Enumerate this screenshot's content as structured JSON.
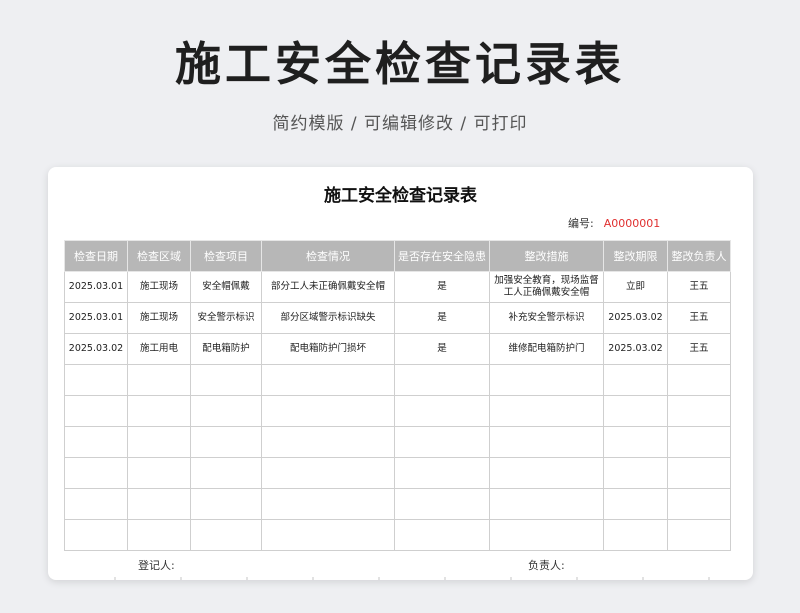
{
  "hero": {
    "title": "施工安全检查记录表",
    "subtitle": "简约模版 / 可编辑修改 / 可打印"
  },
  "sheet": {
    "title": "施工安全检查记录表",
    "serial_label": "编号:",
    "serial_value": "A0000001",
    "columns": [
      "检查日期",
      "检查区域",
      "检查项目",
      "检查情况",
      "是否存在安全隐患",
      "整改措施",
      "整改期限",
      "整改负责人"
    ],
    "rows": [
      [
        "2025.03.01",
        "施工现场",
        "安全帽佩戴",
        "部分工人未正确佩戴安全帽",
        "是",
        "加强安全教育，现场监督工人正确佩戴安全帽",
        "立即",
        "王五"
      ],
      [
        "2025.03.01",
        "施工现场",
        "安全警示标识",
        "部分区域警示标识缺失",
        "是",
        "补充安全警示标识",
        "2025.03.02",
        "王五"
      ],
      [
        "2025.03.02",
        "施工用电",
        "配电箱防护",
        "配电箱防护门损坏",
        "是",
        "维修配电箱防护门",
        "2025.03.02",
        "王五"
      ],
      [
        "",
        "",
        "",
        "",
        "",
        "",
        "",
        ""
      ],
      [
        "",
        "",
        "",
        "",
        "",
        "",
        "",
        ""
      ],
      [
        "",
        "",
        "",
        "",
        "",
        "",
        "",
        ""
      ],
      [
        "",
        "",
        "",
        "",
        "",
        "",
        "",
        ""
      ],
      [
        "",
        "",
        "",
        "",
        "",
        "",
        "",
        ""
      ],
      [
        "",
        "",
        "",
        "",
        "",
        "",
        "",
        ""
      ]
    ],
    "recorder_label": "登记人:",
    "responsible_label": "负责人:"
  },
  "colors": {
    "header_bg": "#b7b7b7",
    "serial_accent": "#e03030",
    "page_bg": "#eeeff2"
  }
}
